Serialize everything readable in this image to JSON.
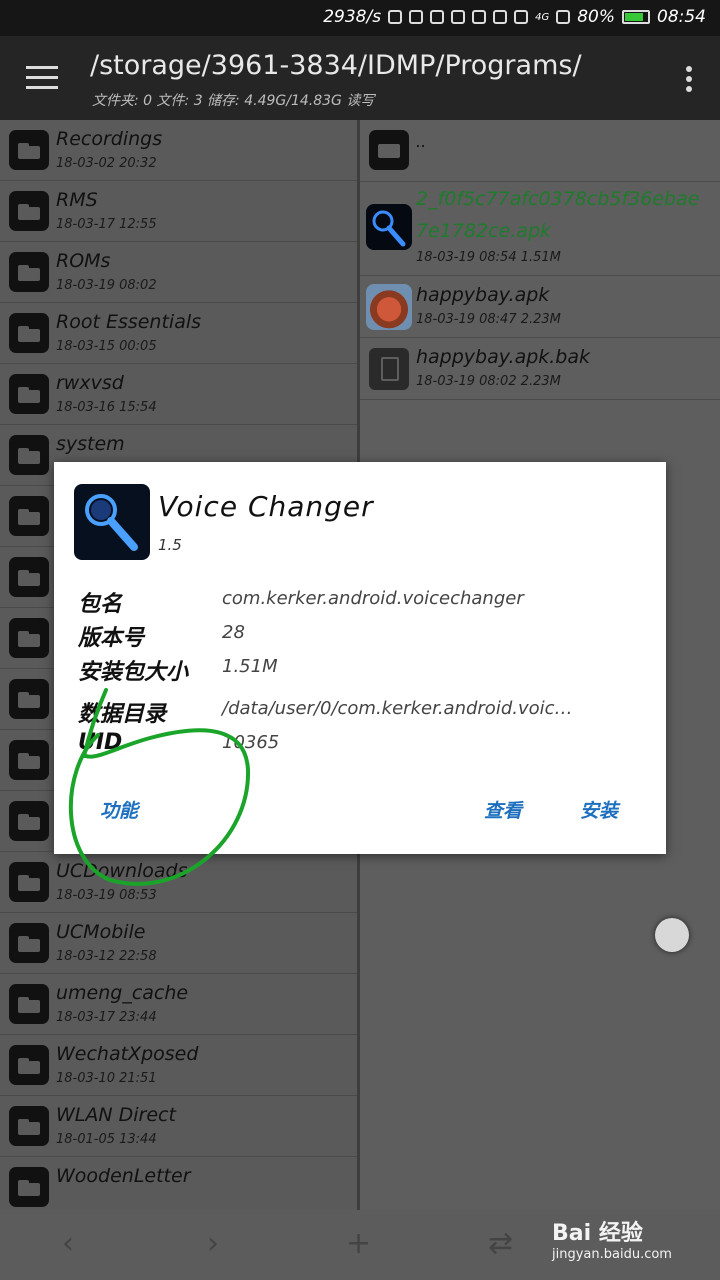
{
  "status_bar": {
    "speed": "2938/s",
    "network": "4G",
    "battery": "80%",
    "time": "08:54"
  },
  "toolbar": {
    "path": "/storage/3961-3834/IDMP/Programs/",
    "info": "文件夹: 0  文件: 3  储存: 4.49G/14.83G  读写"
  },
  "left_list": [
    {
      "name": "Recordings",
      "date": "18-03-02 20:32"
    },
    {
      "name": "RMS",
      "date": "18-03-17 12:55"
    },
    {
      "name": "ROMs",
      "date": "18-03-19 08:02"
    },
    {
      "name": "Root Essentials",
      "date": "18-03-15 00:05"
    },
    {
      "name": "rwxvsd",
      "date": "18-03-16 15:54"
    },
    {
      "name": "system",
      "date": ""
    },
    {
      "name": "",
      "date": ""
    },
    {
      "name": "",
      "date": ""
    },
    {
      "name": "",
      "date": ""
    },
    {
      "name": "",
      "date": ""
    },
    {
      "name": "",
      "date": ""
    },
    {
      "name": "",
      "date": ""
    },
    {
      "name": "UCDownloads",
      "date": "18-03-19 08:53"
    },
    {
      "name": "UCMobile",
      "date": "18-03-12 22:58"
    },
    {
      "name": "umeng_cache",
      "date": "18-03-17 23:44"
    },
    {
      "name": "WechatXposed",
      "date": "18-03-10 21:51"
    },
    {
      "name": "WLAN Direct",
      "date": "18-01-05 13:44"
    },
    {
      "name": "WoodenLetter",
      "date": ""
    }
  ],
  "right_list": {
    "parent": "..",
    "files": [
      {
        "name_line1": "2_f0f5c77afc0378cb5f36ebae",
        "name_line2": "7e1782ce.apk",
        "date": "18-03-19 08:54  1.51M"
      },
      {
        "name": "happybay.apk",
        "date": "18-03-19 08:47  2.23M"
      },
      {
        "name": "happybay.apk.bak",
        "date": "18-03-19 08:02  2.23M"
      }
    ]
  },
  "dialog": {
    "app_name": "Voice Changer",
    "version": "1.5",
    "fields": [
      {
        "label": "包名",
        "value": "com.kerker.android.voicechanger"
      },
      {
        "label": "版本号",
        "value": "28"
      },
      {
        "label": "安装包大小",
        "value": "1.51M"
      },
      {
        "label": "数据目录",
        "value": "/data/user/0/com.kerker.android.voic…"
      },
      {
        "label": "UID",
        "value": "10365"
      }
    ],
    "buttons": {
      "function": "功能",
      "view": "查看",
      "install": "安装"
    }
  },
  "bottom_bar": {
    "back": "‹",
    "forward": "›",
    "add": "+",
    "swap": "⇄"
  },
  "watermark": {
    "brand": "Bai 经验",
    "url": "jingyan.baidu.com"
  },
  "colors": {
    "accent": "#1e6fbf",
    "annotation": "#1aa52a",
    "new_file": "#1d7c2b"
  }
}
